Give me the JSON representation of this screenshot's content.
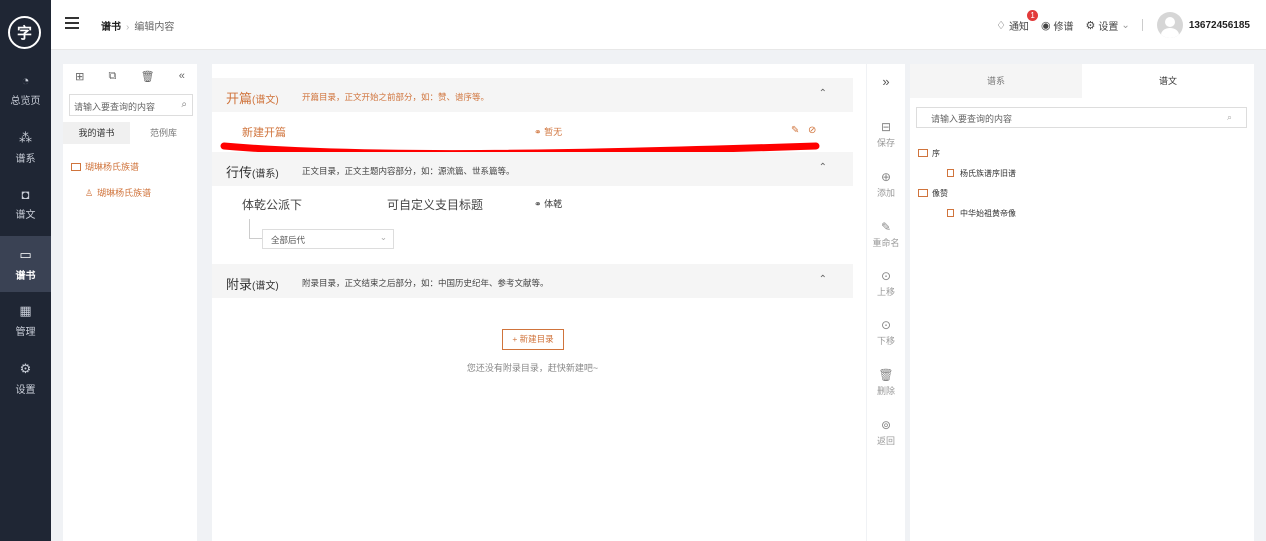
{
  "brand": {
    "logo_text": "字"
  },
  "nav": {
    "items": [
      {
        "label": "总览页",
        "icon": "pie-icon"
      },
      {
        "label": "谱系",
        "icon": "tree-icon"
      },
      {
        "label": "谱文",
        "icon": "doc-icon"
      },
      {
        "label": "谱书",
        "icon": "book-icon",
        "active": true
      },
      {
        "label": "管理",
        "icon": "grid-icon"
      },
      {
        "label": "设置",
        "icon": "gear-icon"
      }
    ]
  },
  "topbar": {
    "breadcrumb": {
      "current": "谱书",
      "child": "编辑内容"
    },
    "notify_label": "通知",
    "notify_count": "1",
    "revise_label": "修谱",
    "settings_label": "设置",
    "username": "13672456185"
  },
  "tree": {
    "search_placeholder": "请输入要查询的内容",
    "tabs": [
      "我的谱书",
      "范例库"
    ],
    "nodes": [
      "瑚琳杨氏族谱",
      "瑚琳杨氏族谱"
    ]
  },
  "sections": {
    "opening": {
      "title": "开篇",
      "kind": "(谱文)",
      "desc": "开篇目录，正文开始之前部分，如：赞、谱序等。",
      "entry": "新建开篇",
      "link_label": "暂无"
    },
    "biography": {
      "title": "行传",
      "kind": "(谱系)",
      "desc": "正文目录，正文主题内容部分，如：源流篇、世系篇等。",
      "entry": "体乾公派下",
      "subtitle": "可自定义支目标题",
      "link_label": "体乾",
      "select_value": "全部后代"
    },
    "appendix": {
      "title": "附录",
      "kind": "(谱文)",
      "desc": "附录目录，正文结束之后部分，如：中国历史纪年、参考文献等。",
      "new_button": "+ 新建目录",
      "empty_tip": "您还没有附录目录，赶快新建吧~"
    }
  },
  "tools": [
    "保存",
    "添加",
    "重命名",
    "上移",
    "下移",
    "删除",
    "返回"
  ],
  "right": {
    "tabs": [
      "谱系",
      "谱文"
    ],
    "search_placeholder": "请输入要查询的内容",
    "folders": [
      {
        "label": "序",
        "files": [
          "杨氏族谱序旧谱"
        ]
      },
      {
        "label": "像赞",
        "files": [
          "中华始祖黄帝像"
        ]
      }
    ]
  },
  "colors": {
    "accent": "#d0743c",
    "nav_bg": "#1f2634",
    "badge": "#e23a3a",
    "annotation": "#ff0000"
  }
}
